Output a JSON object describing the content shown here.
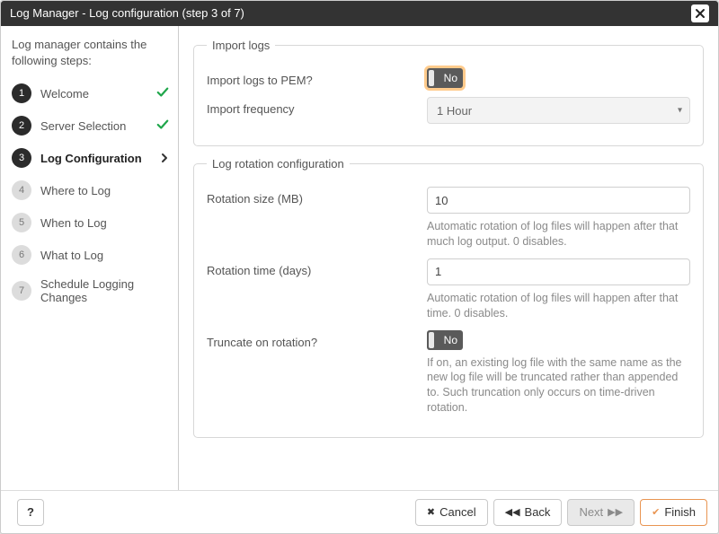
{
  "title": "Log Manager - Log configuration (step 3 of 7)",
  "sidebar": {
    "intro": "Log manager contains the following steps:",
    "steps": [
      {
        "label": "Welcome",
        "state": "done",
        "i": "1"
      },
      {
        "label": "Server Selection",
        "state": "done",
        "i": "2"
      },
      {
        "label": "Log Configuration",
        "state": "active",
        "i": "3"
      },
      {
        "label": "Where to Log",
        "state": "future",
        "i": "4"
      },
      {
        "label": "When to Log",
        "state": "future",
        "i": "5"
      },
      {
        "label": "What to Log",
        "state": "future",
        "i": "6"
      },
      {
        "label": "Schedule Logging Changes",
        "state": "future",
        "i": "7"
      }
    ]
  },
  "groups": {
    "import": {
      "legend": "Import logs",
      "import_to_pem": {
        "label": "Import logs to PEM?",
        "value": "No"
      },
      "frequency": {
        "label": "Import frequency",
        "value": "1 Hour"
      }
    },
    "rotation": {
      "legend": "Log rotation configuration",
      "size": {
        "label": "Rotation size (MB)",
        "value": "10",
        "help": "Automatic rotation of log files will happen after that much log output. 0 disables."
      },
      "time": {
        "label": "Rotation time (days)",
        "value": "1",
        "help": "Automatic rotation of log files will happen after that time. 0 disables."
      },
      "truncate": {
        "label": "Truncate on rotation?",
        "value": "No",
        "help": "If on, an existing log file with the same name as the new log file will be truncated rather than appended to. Such truncation only occurs on time-driven rotation."
      }
    }
  },
  "footer": {
    "help": "?",
    "cancel": "Cancel",
    "back": "Back",
    "next": "Next",
    "finish": "Finish"
  },
  "colors": {
    "accent": "#e99552",
    "check": "#1fa64a"
  }
}
